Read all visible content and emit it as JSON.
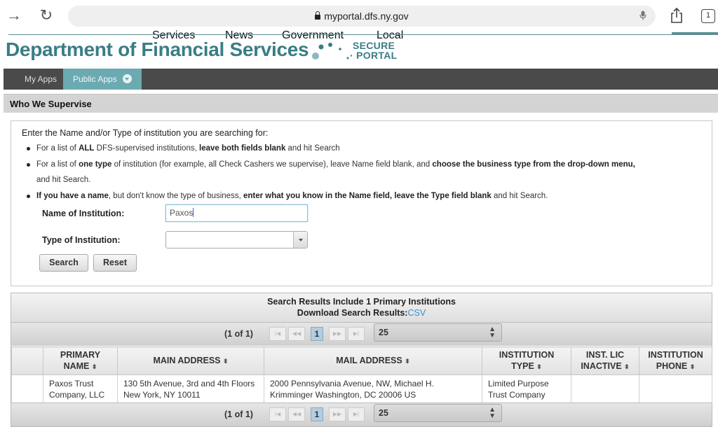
{
  "browser": {
    "url": "myportal.dfs.ny.gov",
    "tab_count": "1"
  },
  "site": {
    "top_nav": [
      "Services",
      "News",
      "Government",
      "Local"
    ],
    "title": "Department of Financial Services",
    "secure_line1": "SECURE",
    "secure_line2": "PORTAL",
    "brand_color": "#3a7d86"
  },
  "app_bar": {
    "tabs": [
      {
        "label": "My Apps"
      },
      {
        "label": "Public Apps"
      }
    ]
  },
  "section": {
    "title": "Who We Supervise"
  },
  "search": {
    "intro": "Enter the Name and/or Type of institution you are searching for:",
    "bullet1": {
      "a": "For a list of ",
      "b": "ALL",
      "c": " DFS-supervised institutions, ",
      "d": "leave both fields blank",
      "e": " and hit Search"
    },
    "bullet2": {
      "a": "For a list of ",
      "b": "one type",
      "c": " of institution (for example, all Check Cashers we supervise), leave Name field blank, and ",
      "d": "choose the business type from the drop-down menu,",
      "e": "and hit Search."
    },
    "bullet3": {
      "a": "If you have a name",
      "b": ", but don't know the type of business, ",
      "c": "enter what you know in the Name field, leave the Type field blank",
      "d": " and hit Search."
    },
    "name_label": "Name of Institution:",
    "name_value": "Paxos",
    "type_label": "Type of Institution:",
    "type_value": "",
    "search_button": "Search",
    "reset_button": "Reset"
  },
  "results": {
    "summary": "Search Results Include 1 Primary Institutions",
    "download_label": "Download Search Results:",
    "download_link": "CSV",
    "page_info": "(1 of 1)",
    "current_page": "1",
    "per_page": "25",
    "columns": [
      {
        "line1": "PRIMARY",
        "line2": "NAME"
      },
      {
        "line1": "MAIN ADDRESS",
        "line2": ""
      },
      {
        "line1": "MAIL ADDRESS",
        "line2": ""
      },
      {
        "line1": "INSTITUTION",
        "line2": "TYPE"
      },
      {
        "line1": "INST. LIC",
        "line2": "INACTIVE"
      },
      {
        "line1": "INSTITUTION",
        "line2": "PHONE"
      }
    ],
    "rows": [
      {
        "name": "Paxos Trust Company, LLC",
        "main_address": "130 5th Avenue, 3rd and 4th Floors New York, NY 10011",
        "mail_address": "2000 Pennsylvania Avenue, NW, Michael H. Krimminger Washington, DC 20006 US",
        "type": "Limited Purpose Trust Company",
        "inactive": "",
        "phone": ""
      }
    ]
  }
}
